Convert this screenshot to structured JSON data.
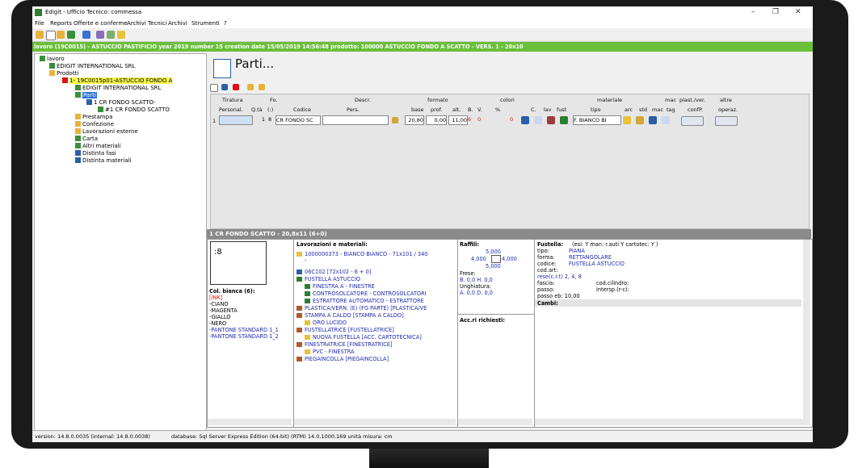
{
  "window": {
    "title": "Edigit - Ufficio Tecnico: commessa"
  },
  "menu": [
    "File",
    "Reports",
    "Offerte e conferme",
    "Archivi Tecnici",
    "Archivi",
    "Strumenti",
    "?"
  ],
  "job_bar": "lavoro (19C0015) - ASTUCCIO PASTIFICIO year 2019 number 15 creation date 15/05/2019 14:56:48   prodotto: 100000 ASTUCCIO FONDO A SCATTO - VERS. 1 - 20x10",
  "tree": {
    "root": "lavoro",
    "client": "EDIGIT INTERNATIONAL SRL",
    "prodotti": "Prodotti",
    "product": "1- 19C0015p01-ASTUCCIO FONDO A",
    "client2": "EDIGIT INTERNATIONAL SRL",
    "parti": "Parti",
    "part": "1 CR FONDO SCATTO-",
    "part_sub": "#1 CR FONDO SCATTO",
    "items": [
      "Prestampa",
      "Confezione",
      "Lavorazioni esterne",
      "Carta",
      "Altri materiali",
      "Distinta fasi",
      "Distinta materiali"
    ]
  },
  "main": {
    "title": "Parti...",
    "headers_top": [
      "Tiratura",
      "Fo.",
      "Descr.",
      "formato",
      "colori",
      "materiale",
      "mac",
      "plast./ver.",
      "altre"
    ],
    "headers_bottom": [
      "Personal.",
      "Q.tà",
      "(:)",
      "Codice",
      "Pers.",
      "base",
      "prof.",
      "alt.",
      "B.",
      "V.",
      "%",
      "C.",
      "lav",
      "fust",
      "tipo",
      "arc",
      "std",
      "mac",
      "tag",
      "confP.",
      "operaz."
    ],
    "row": {
      "n": "1",
      "qta": "1",
      "fo": "8",
      "codice": "CR FONDO SC",
      "base": "20,80",
      "prof": "0,00",
      "alt": "11,00",
      "b": "6",
      "v": "0",
      "pct": "0",
      "tipo": "F. BIANCO BI"
    }
  },
  "detail_title": "1 CR FONDO SCATTO - 20,8x11 (6+0)",
  "left_pane": {
    "num": ":8",
    "col_header": "Col. bianca (6):",
    "colors": [
      "[INK]",
      "-CIANO",
      "-MAGENTA",
      "-GIALLO",
      "-NERO",
      "-PANTONE STANDARD 1_1",
      "-PANTONE STANDARD 1_2"
    ]
  },
  "lav_pane": {
    "header": "Lavorazioni e materiali:",
    "lines": [
      "1000000373 - BIANCO BIANCO - 71x101 / 340",
      "-",
      "06C102 [72x102 - 6 + 0]",
      "FUSTELLA ASTUCCIO",
      "FINESTRA A - FINESTRE",
      "CONTROSOLCATORE - CONTROSOLCATORI",
      "ESTRATTORE AUTOMATICO - ESTRATTORE",
      "PLASTICA/VERN. (E) (FG PARTE) [PLASTICA/VE",
      "STAMPA A CALDO [STAMPA A CALDO]",
      "ORO LUCIDO",
      "FUSTELLATRICE [FUSTELLATRICE]",
      "NUOVA FUSTELLA [ACC. CARTOTECNICA]",
      "FINESTRATRICE [FINESTRATRICE]",
      "PVC - FINESTRA",
      "PIEGAINCOLLA [PIEGAINCOLLA]"
    ]
  },
  "raffili": {
    "header": "Raffili:",
    "top": "5,000",
    "left": "4,000",
    "right": "4,000",
    "bottom": "5,000",
    "frese": "Frese:",
    "b_h": "B.  0,0     H.  0,0",
    "unghiatura": "Unghiatura:",
    "a_d": "A.  0,0     D.  0,0",
    "acc": "Acc.ri richiesti:"
  },
  "fustella": {
    "header": "Fustella:",
    "flags": "(esi:   Y  man:      r.auti  Y  cartotec:  Y  )",
    "tipo_label": "tipo:",
    "tipo": "PIANA",
    "forma_label": "forma:",
    "forma": "RETTANGOLARE",
    "codice_label": "codice:",
    "codice": "FUSTELLA ASTUCCIO",
    "codart": "cod.art:",
    "rese": "rese(c.r.t) 2, 4, 8",
    "fascia": "fascia:",
    "cod_cil": "cod.cilindro:",
    "passo": "passo:",
    "intersp": "intersp.(r-c):",
    "passo_eb": "passo eb: 10,00",
    "cambi": "Cambi:"
  },
  "statusbar": {
    "version": "version: 14.8.0.0035 (internal: 14.8.0.0038)",
    "db": "database: Sql Server Express Edition (64-bit) (RTM) 14.0.1000.169   unità misura: cm"
  },
  "colors": {
    "green": "#6abf3a",
    "highlight": "#f6f64a",
    "link_blue": "#1f2aa8",
    "ink_red": "#d11111"
  }
}
